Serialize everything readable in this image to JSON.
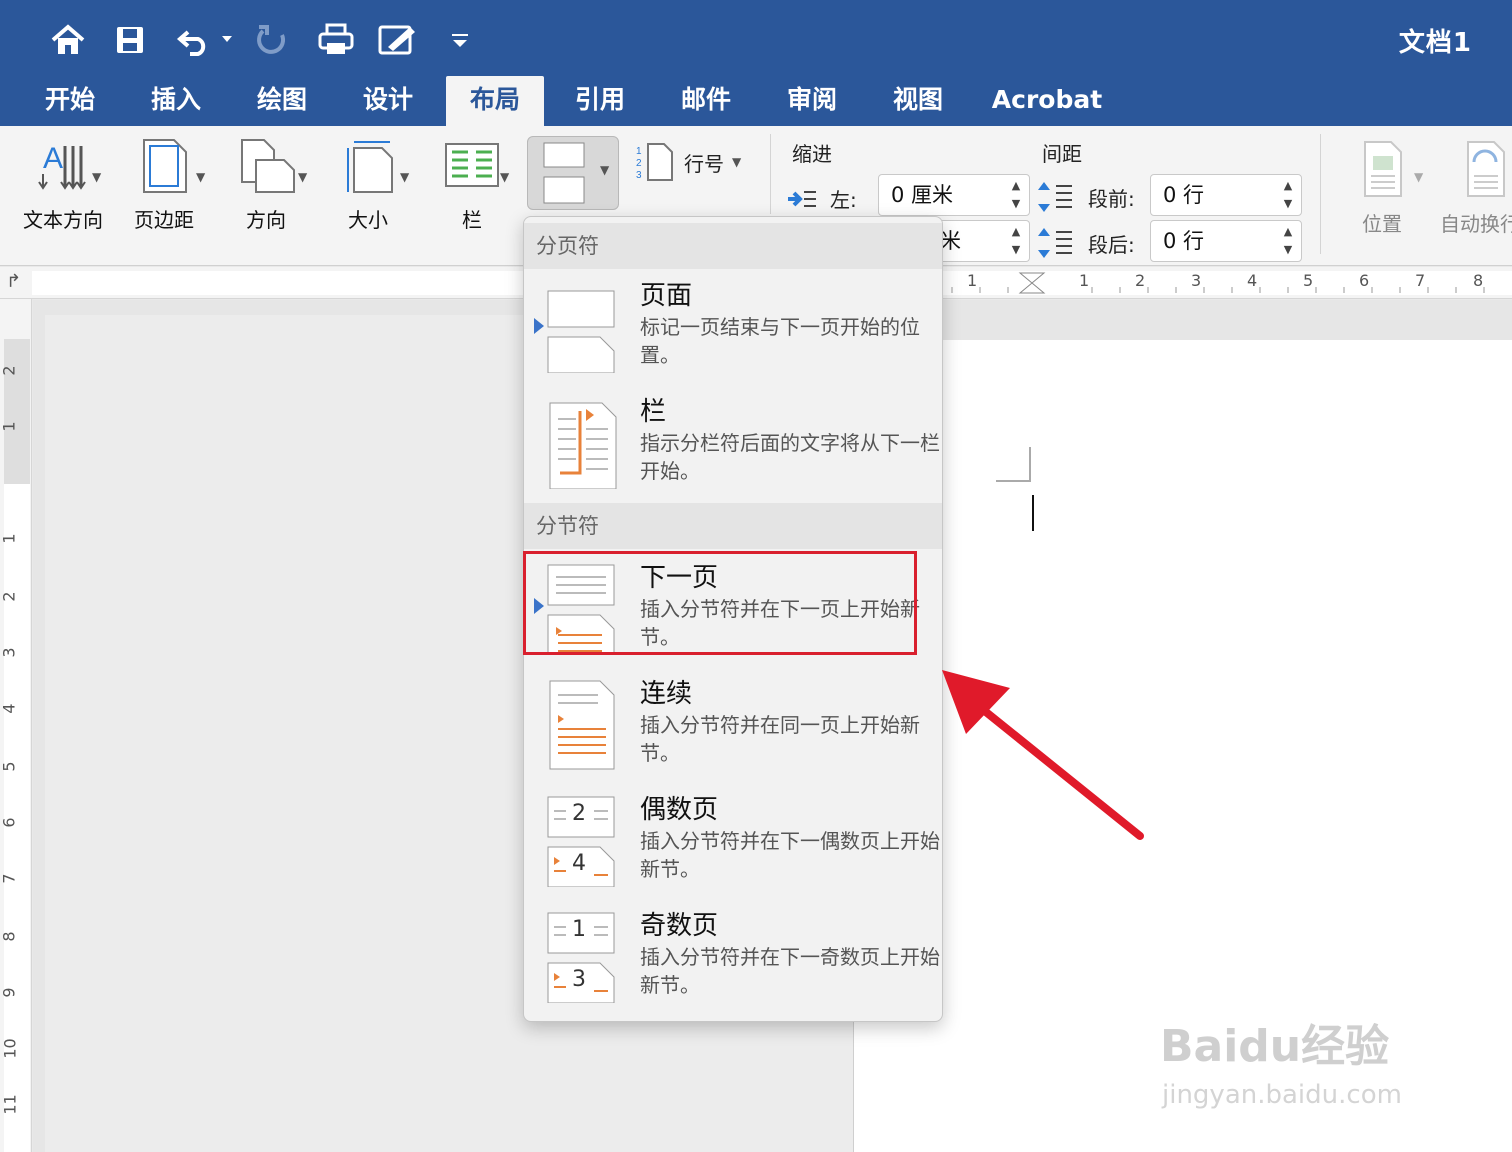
{
  "app": {
    "doc_title": "文档1"
  },
  "quick_access": [
    "home-icon",
    "save-icon",
    "undo-icon",
    "redo-icon",
    "print-icon",
    "edit-icon",
    "customize-icon"
  ],
  "tabs": [
    {
      "label": "开始"
    },
    {
      "label": "插入"
    },
    {
      "label": "绘图"
    },
    {
      "label": "设计"
    },
    {
      "label": "布局",
      "active": true
    },
    {
      "label": "引用"
    },
    {
      "label": "邮件"
    },
    {
      "label": "审阅"
    },
    {
      "label": "视图"
    },
    {
      "label": "Acrobat"
    }
  ],
  "ribbon": {
    "text_direction": "文本方向",
    "margins": "页边距",
    "orientation": "方向",
    "size": "大小",
    "columns": "栏",
    "line_numbers": "行号",
    "indent_label": "缩进",
    "spacing_label": "间距",
    "indent_left_label": "左:",
    "indent_left_value": "0 厘米",
    "indent_right_partial": "米",
    "space_before_label": "段前:",
    "space_before_value": "0 行",
    "space_after_label": "段后:",
    "space_after_value": "0 行",
    "position": "位置",
    "wrap_text": "自动换行"
  },
  "vertical_ruler": [
    "2",
    "1",
    "1",
    "2",
    "3",
    "4",
    "5",
    "6",
    "7",
    "8",
    "9",
    "10",
    "11"
  ],
  "horizontal_ruler": [
    "1",
    "1",
    "2",
    "3",
    "4",
    "5",
    "6",
    "7",
    "8"
  ],
  "dropdown": {
    "page_breaks_header": "分页符",
    "section_breaks_header": "分节符",
    "items": [
      {
        "title": "页面",
        "desc": "标记一页结束与下一页开始的位置。"
      },
      {
        "title": "栏",
        "desc": "指示分栏符后面的文字将从下一栏开始。"
      },
      {
        "title": "下一页",
        "desc": "插入分节符并在下一页上开始新节。"
      },
      {
        "title": "连续",
        "desc": "插入分节符并在同一页上开始新节。"
      },
      {
        "title": "偶数页",
        "desc": "插入分节符并在下一偶数页上开始新节。"
      },
      {
        "title": "奇数页",
        "desc": "插入分节符并在下一奇数页上开始新节。"
      }
    ],
    "thumb_numbers": {
      "even_top": "2",
      "even_bottom": "4",
      "odd_top": "1",
      "odd_bottom": "3"
    }
  },
  "colors": {
    "brand_blue": "#2b579a",
    "highlight_red": "#d9202e",
    "accent_orange": "#e8823a"
  },
  "watermark": {
    "brand": "Baidu经验",
    "url": "jingyan.baidu.com"
  }
}
